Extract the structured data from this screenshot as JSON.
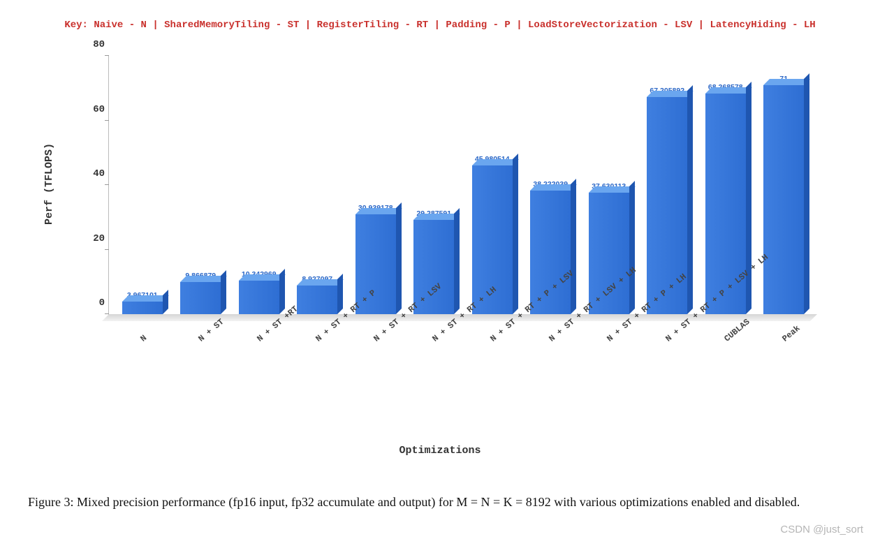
{
  "key_line": "Key: Naive - N  |  SharedMemoryTiling - ST  |  RegisterTiling - RT  |  Padding - P  |  LoadStoreVectorization - LSV  |  LatencyHiding - LH",
  "chart_data": {
    "type": "bar",
    "title": "",
    "xlabel": "Optimizations",
    "ylabel": "Perf (TFLOPS)",
    "ylim": [
      0,
      80
    ],
    "yticks": [
      0,
      20,
      40,
      60,
      80
    ],
    "categories": [
      "N",
      "N + ST",
      "N + ST +RT",
      "N + ST + RT + P",
      "N + ST + RT + LSV",
      "N + ST + RT + LH",
      "N + ST + RT + P + LSV",
      "N + ST + RT + LSV + LH",
      "N + ST + RT + P + LH",
      "N + ST + RT + P + LSV + LH",
      "CUBLAS",
      "Peak"
    ],
    "values": [
      3.967101,
      9.866879,
      10.342969,
      8.927097,
      30.939178,
      29.287591,
      45.980514,
      38.222039,
      37.630113,
      67.205892,
      68.268578,
      71
    ],
    "value_labels": [
      "3.967101",
      "9.866879",
      "10.342969",
      "8.927097",
      "30.939178",
      "29.287591",
      "45.980514",
      "38.222039",
      "37.630113",
      "67.205892",
      "68.268578",
      "71"
    ]
  },
  "caption": "Figure 3: Mixed precision performance (fp16 input, fp32 accumulate and output) for M = N = K = 8192 with various optimizations enabled and disabled.",
  "watermark": "CSDN @just_sort"
}
